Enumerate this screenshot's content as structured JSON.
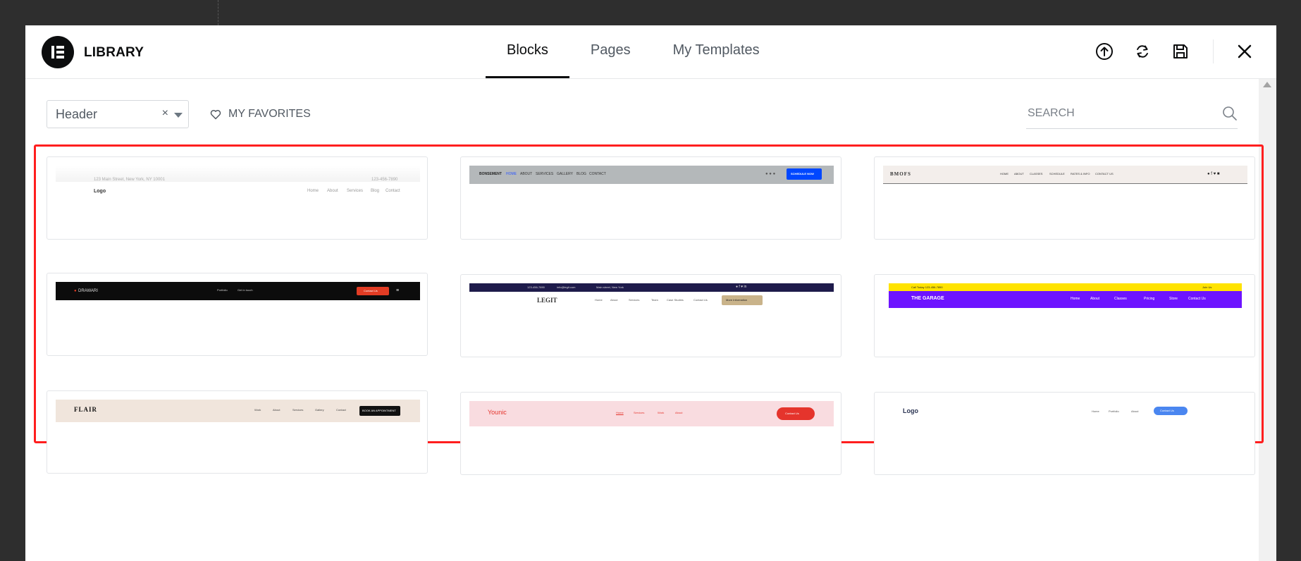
{
  "header": {
    "title": "LIBRARY",
    "tabs": [
      {
        "label": "Blocks",
        "active": true
      },
      {
        "label": "Pages",
        "active": false
      },
      {
        "label": "My Templates",
        "active": false
      }
    ],
    "icons": [
      "upload-icon",
      "sync-icon",
      "save-icon",
      "close-icon"
    ]
  },
  "toolbar": {
    "category_value": "Header",
    "clear_symbol": "×",
    "favorites_label": "MY FAVORITES",
    "search_placeholder": "SEARCH"
  },
  "colors": {
    "accent": "#0c0d0e",
    "highlight": "#ff1e1e",
    "t2_btn": "#0047ff",
    "t4_btn": "#e23c24",
    "t5_btn": "#c9b38a",
    "t6_bar": "#6d14ff",
    "t6_top": "#ffe300",
    "t8_btn": "#e5342c",
    "t9_btn": "#4a86f0"
  },
  "templates": [
    {
      "name": "header-template-1",
      "logo": "Logo",
      "topbar": "123 Main Street, New York, NY 10001",
      "phone": "123-456-7890",
      "nav": [
        "Home",
        "About",
        "Services",
        "Blog",
        "Contact"
      ]
    },
    {
      "name": "header-template-2",
      "logo": "BONSEMENT",
      "nav": [
        "HOME",
        "ABOUT",
        "SERVICES",
        "GALLERY",
        "BLOG",
        "CONTACT"
      ],
      "button": "SCHEDULE NOW"
    },
    {
      "name": "header-template-3",
      "logo": "BMOFS",
      "nav": [
        "HOME",
        "ABOUT",
        "CLASSES",
        "SCHEDULE",
        "RATES & INFO",
        "CONTACT US"
      ]
    },
    {
      "name": "header-template-4",
      "logo": "DRAWARI",
      "nav": [
        "Portfolio",
        "Get in touch"
      ],
      "button": "Contact Us"
    },
    {
      "name": "header-template-5",
      "logo": "LEGIT",
      "topbar": [
        "123-456-7890",
        "info@legit.com",
        "Main street, New York"
      ],
      "nav": [
        "Home",
        "About",
        "Services",
        "Team",
        "Case Studies",
        "Contact Us"
      ],
      "button": "More Information"
    },
    {
      "name": "header-template-6",
      "logo": "THE GARAGE",
      "topbar": "Call Today 123-456-7890",
      "topbar_right": "Join Us",
      "nav": [
        "Home",
        "About",
        "Classes",
        "Pricing",
        "Store",
        "Contact Us"
      ]
    },
    {
      "name": "header-template-7",
      "logo": "FLAIR",
      "nav": [
        "Work",
        "About",
        "Services",
        "Gallery",
        "Contact"
      ],
      "button": "BOOK AN APPOINTMENT"
    },
    {
      "name": "header-template-8",
      "logo": "Younic",
      "nav": [
        "Home",
        "Services",
        "Work",
        "About"
      ],
      "button": "Contact Us"
    },
    {
      "name": "header-template-9",
      "logo": "Logo",
      "nav": [
        "Home",
        "Portfolio",
        "About"
      ],
      "button": "Contact Us"
    }
  ]
}
